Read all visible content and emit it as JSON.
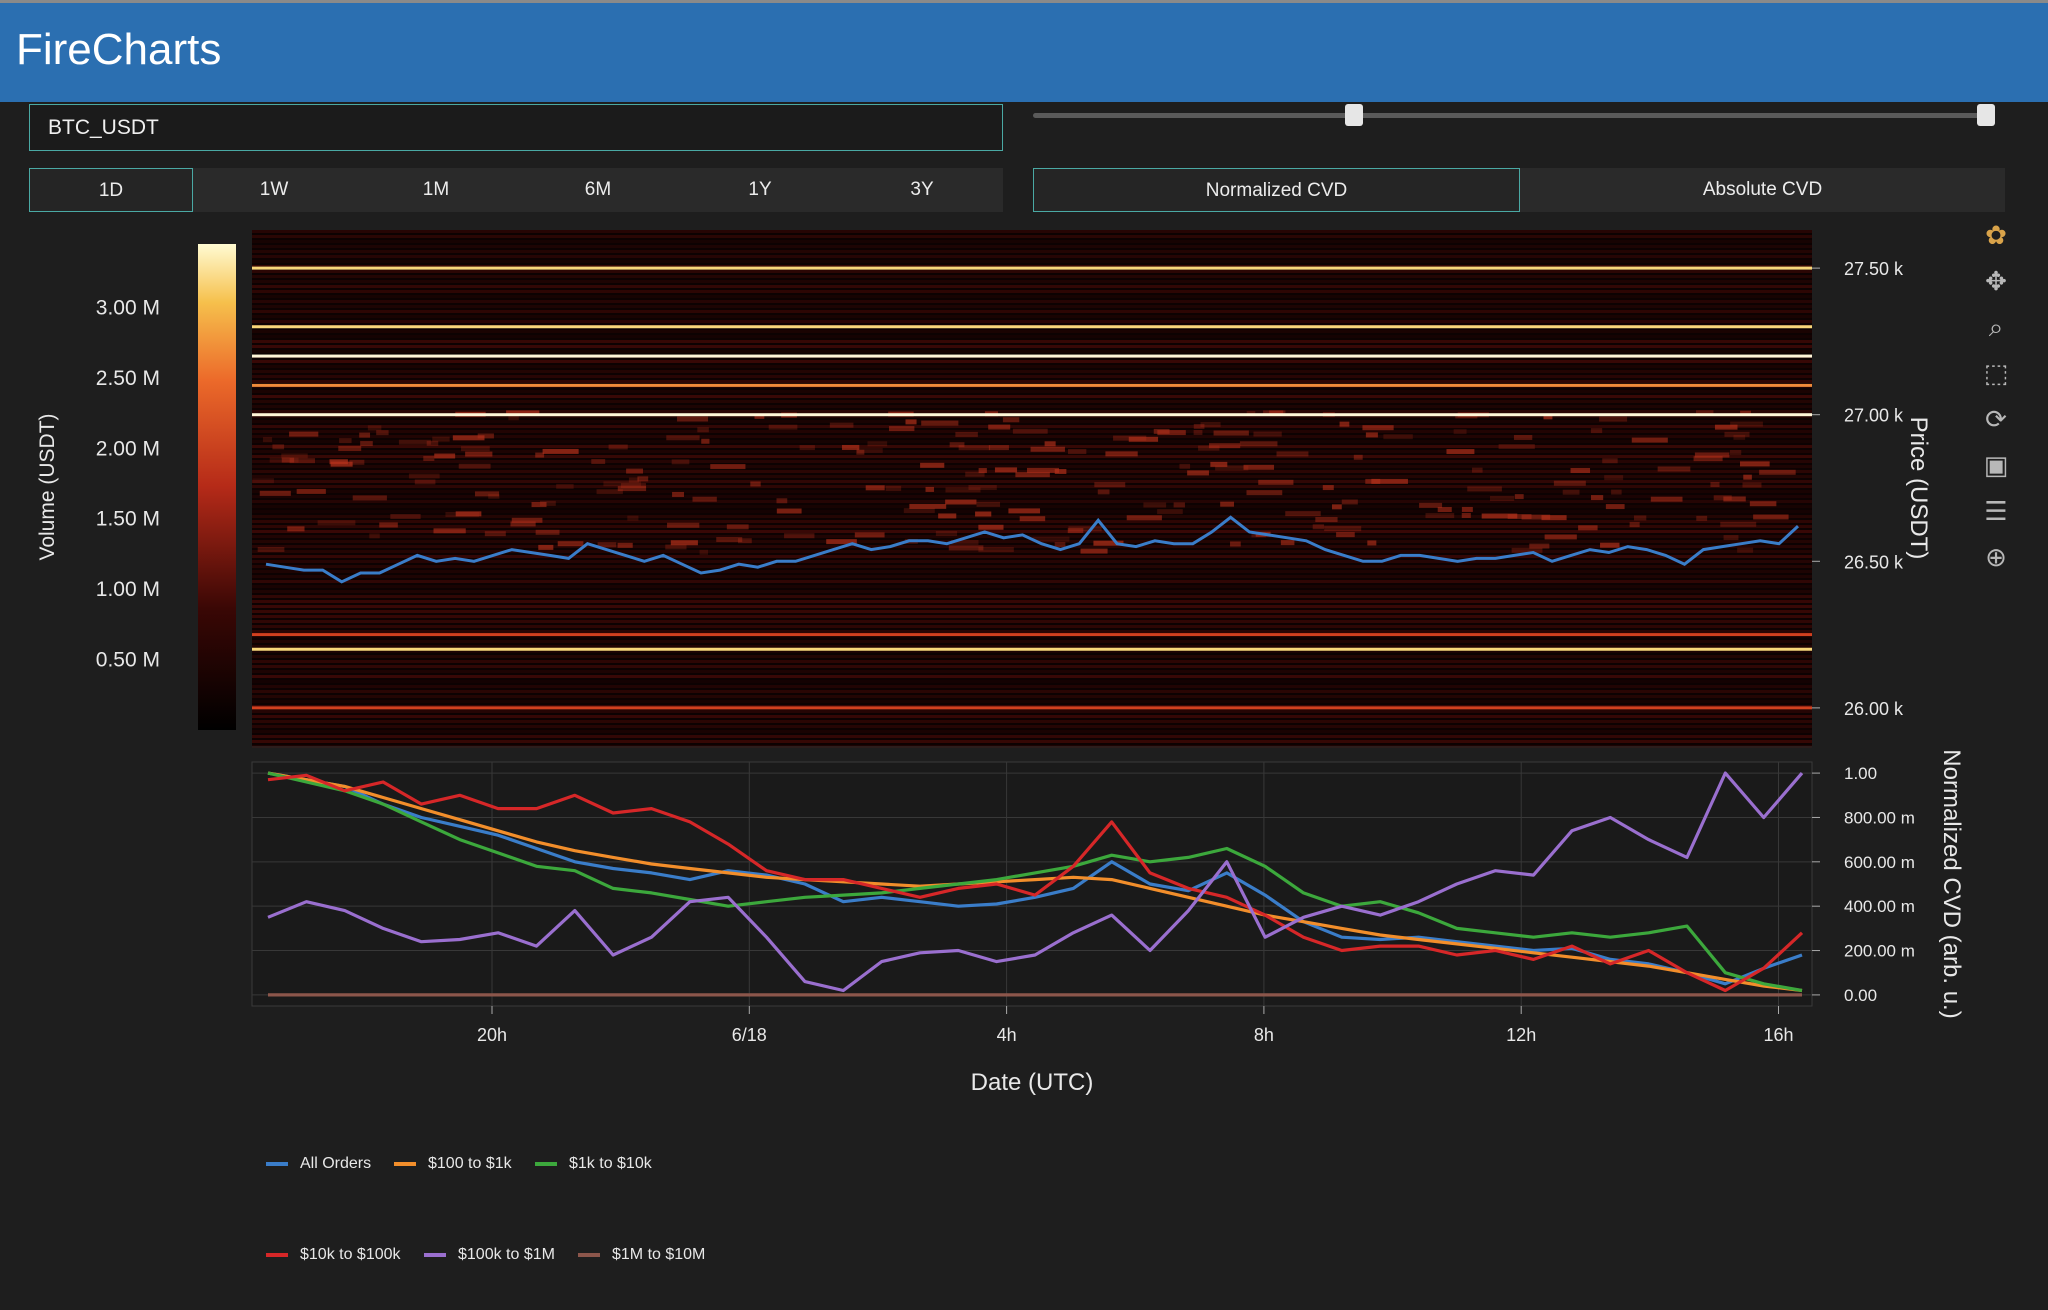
{
  "app": {
    "title": "FireCharts"
  },
  "symbol": {
    "value": "BTC_USDT"
  },
  "date_slider": {
    "low": 0.33,
    "high": 1.0
  },
  "range_buttons": [
    {
      "label": "1D",
      "active": true
    },
    {
      "label": "1W",
      "active": false
    },
    {
      "label": "1M",
      "active": false
    },
    {
      "label": "6M",
      "active": false
    },
    {
      "label": "1Y",
      "active": false
    },
    {
      "label": "3Y",
      "active": false
    }
  ],
  "cvd_buttons": [
    {
      "label": "Normalized CVD",
      "active": true
    },
    {
      "label": "Absolute CVD",
      "active": false
    }
  ],
  "modebar_icons": [
    "plotly-logo-icon",
    "pan-icon",
    "zoom-icon",
    "box-select-icon",
    "reset-icon",
    "save-icon",
    "hover-compare-icon",
    "spike-lines-icon"
  ],
  "colors": {
    "accent": "#4aa9a4",
    "header": "#2b6fb1",
    "price_line": "#3a7dc9"
  },
  "chart_data": [
    {
      "type": "heatmap",
      "title": "",
      "xlabel": "Date (UTC)",
      "ylabel": "Price (USDT)",
      "colorbar": {
        "label": "Volume (USDT)",
        "ticks": [
          "0.50 M",
          "1.00 M",
          "1.50 M",
          "2.00 M",
          "2.50 M",
          "3.00 M"
        ],
        "tick_values": [
          0.5,
          1.0,
          1.5,
          2.0,
          2.5,
          3.0
        ],
        "range": [
          0,
          3.45
        ]
      },
      "y_ticks": [
        "26.00 k",
        "26.50 k",
        "27.00 k",
        "27.50 k"
      ],
      "y_tick_values": [
        26000,
        26500,
        27000,
        27500
      ],
      "ylim": [
        25870,
        27630
      ],
      "bright_levels": [
        {
          "price": 27500,
          "intensity": 0.85
        },
        {
          "price": 27300,
          "intensity": 0.9
        },
        {
          "price": 27200,
          "intensity": 0.95
        },
        {
          "price": 27100,
          "intensity": 0.6
        },
        {
          "price": 27000,
          "intensity": 0.95
        },
        {
          "price": 26200,
          "intensity": 0.8
        },
        {
          "price": 26250,
          "intensity": 0.55
        },
        {
          "price": 26000,
          "intensity": 0.5
        }
      ],
      "price_series": {
        "name": "",
        "values": [
          26490,
          26480,
          26470,
          26470,
          26430,
          26460,
          26460,
          26490,
          26520,
          26500,
          26510,
          26500,
          26520,
          26540,
          26530,
          26520,
          26510,
          26560,
          26540,
          26520,
          26500,
          26520,
          26490,
          26460,
          26470,
          26490,
          26480,
          26500,
          26500,
          26520,
          26540,
          26560,
          26540,
          26550,
          26570,
          26570,
          26560,
          26580,
          26600,
          26580,
          26590,
          26560,
          26540,
          26560,
          26640,
          26560,
          26550,
          26570,
          26560,
          26560,
          26600,
          26650,
          26600,
          26590,
          26580,
          26570,
          26540,
          26520,
          26500,
          26500,
          26520,
          26520,
          26510,
          26500,
          26510,
          26510,
          26520,
          26530,
          26500,
          26520,
          26540,
          26530,
          26550,
          26540,
          26520,
          26490,
          26540,
          26550,
          26560,
          26570,
          26560,
          26620
        ]
      }
    },
    {
      "type": "line",
      "title": "",
      "xlabel": "Date (UTC)",
      "ylabel": "Normalized CVD (arb. u.)",
      "x_ticks": [
        "20h",
        "6/18",
        "4h",
        "8h",
        "12h",
        "16h"
      ],
      "y_ticks": [
        "0.00",
        "200.00 m",
        "400.00 m",
        "600.00 m",
        "800.00 m",
        "1.00"
      ],
      "y_tick_values": [
        0,
        0.2,
        0.4,
        0.6,
        0.8,
        1.0
      ],
      "ylim": [
        -0.05,
        1.05
      ],
      "series": [
        {
          "name": "All Orders",
          "color": "#3a7dc9",
          "values": [
            1.0,
            0.97,
            0.94,
            0.86,
            0.8,
            0.76,
            0.72,
            0.66,
            0.6,
            0.57,
            0.55,
            0.52,
            0.56,
            0.54,
            0.5,
            0.42,
            0.44,
            0.42,
            0.4,
            0.41,
            0.44,
            0.48,
            0.6,
            0.5,
            0.47,
            0.55,
            0.45,
            0.33,
            0.26,
            0.25,
            0.26,
            0.24,
            0.22,
            0.2,
            0.21,
            0.16,
            0.14,
            0.1,
            0.05,
            0.12,
            0.18
          ]
        },
        {
          "name": "$100 to $1k",
          "color": "#f28e2b",
          "values": [
            1.0,
            0.97,
            0.94,
            0.89,
            0.84,
            0.79,
            0.74,
            0.69,
            0.65,
            0.62,
            0.59,
            0.57,
            0.55,
            0.53,
            0.52,
            0.51,
            0.5,
            0.49,
            0.5,
            0.51,
            0.52,
            0.53,
            0.52,
            0.48,
            0.44,
            0.4,
            0.36,
            0.33,
            0.3,
            0.27,
            0.25,
            0.23,
            0.21,
            0.19,
            0.17,
            0.15,
            0.13,
            0.1,
            0.07,
            0.04,
            0.02
          ]
        },
        {
          "name": "$1k to $10k",
          "color": "#3ca83c",
          "values": [
            1.0,
            0.96,
            0.92,
            0.86,
            0.78,
            0.7,
            0.64,
            0.58,
            0.56,
            0.48,
            0.46,
            0.43,
            0.4,
            0.42,
            0.44,
            0.45,
            0.46,
            0.48,
            0.5,
            0.52,
            0.55,
            0.58,
            0.63,
            0.6,
            0.62,
            0.66,
            0.58,
            0.46,
            0.4,
            0.42,
            0.37,
            0.3,
            0.28,
            0.26,
            0.28,
            0.26,
            0.28,
            0.31,
            0.1,
            0.05,
            0.02
          ]
        },
        {
          "name": "$10k to $100k",
          "color": "#d62728",
          "values": [
            0.97,
            0.99,
            0.92,
            0.96,
            0.86,
            0.9,
            0.84,
            0.84,
            0.9,
            0.82,
            0.84,
            0.78,
            0.68,
            0.56,
            0.52,
            0.52,
            0.48,
            0.44,
            0.48,
            0.5,
            0.45,
            0.58,
            0.78,
            0.55,
            0.48,
            0.44,
            0.36,
            0.26,
            0.2,
            0.22,
            0.22,
            0.18,
            0.2,
            0.16,
            0.22,
            0.14,
            0.2,
            0.1,
            0.02,
            0.12,
            0.28
          ]
        },
        {
          "name": "$100k to $1M",
          "color": "#9a6fcf",
          "values": [
            0.35,
            0.42,
            0.38,
            0.3,
            0.24,
            0.25,
            0.28,
            0.22,
            0.38,
            0.18,
            0.26,
            0.42,
            0.44,
            0.26,
            0.06,
            0.02,
            0.15,
            0.19,
            0.2,
            0.15,
            0.18,
            0.28,
            0.36,
            0.2,
            0.38,
            0.6,
            0.26,
            0.35,
            0.4,
            0.36,
            0.42,
            0.5,
            0.56,
            0.54,
            0.74,
            0.8,
            0.7,
            0.62,
            1.0,
            0.8,
            1.0
          ]
        },
        {
          "name": "$1M to $10M",
          "color": "#8c564b",
          "values": [
            0,
            0,
            0,
            0,
            0,
            0,
            0,
            0,
            0,
            0,
            0,
            0,
            0,
            0,
            0,
            0,
            0,
            0,
            0,
            0,
            0,
            0,
            0,
            0,
            0,
            0,
            0,
            0,
            0,
            0,
            0,
            0,
            0,
            0,
            0,
            0,
            0,
            0,
            0,
            0,
            0
          ]
        }
      ],
      "legend_position": "bottom-left"
    }
  ]
}
